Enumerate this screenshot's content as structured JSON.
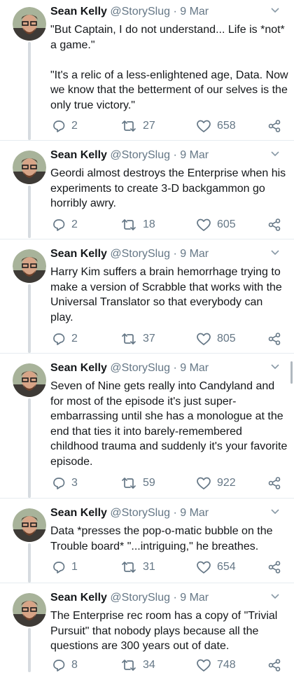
{
  "tweets": [
    {
      "name": "Sean Kelly",
      "handle": "@StorySlug",
      "sep": "·",
      "date": "9 Mar",
      "paragraphs": [
        "\"But Captain, I do not understand... Life is *not* a game.\"",
        "\"It's a relic of a less-enlightened age, Data. Now we know that the betterment of our selves is the only true victory.\""
      ],
      "replies": "2",
      "retweets": "27",
      "likes": "658"
    },
    {
      "name": "Sean Kelly",
      "handle": "@StorySlug",
      "sep": "·",
      "date": "9 Mar",
      "paragraphs": [
        "Geordi almost destroys the Enterprise when his experiments to create 3-D backgammon go horribly awry."
      ],
      "replies": "2",
      "retweets": "18",
      "likes": "605"
    },
    {
      "name": "Sean Kelly",
      "handle": "@StorySlug",
      "sep": "·",
      "date": "9 Mar",
      "paragraphs": [
        "Harry Kim suffers a brain hemorrhage trying to make a version of Scrabble that works with the Universal Translator so that everybody can play."
      ],
      "replies": "2",
      "retweets": "37",
      "likes": "805"
    },
    {
      "name": "Sean Kelly",
      "handle": "@StorySlug",
      "sep": "·",
      "date": "9 Mar",
      "paragraphs": [
        "Seven of Nine gets really into Candyland and for most of the episode it's just super-embarrassing until she has a monologue at the end that ties it into barely-remembered childhood trauma and suddenly it's your favorite episode."
      ],
      "replies": "3",
      "retweets": "59",
      "likes": "922"
    },
    {
      "name": "Sean Kelly",
      "handle": "@StorySlug",
      "sep": "·",
      "date": "9 Mar",
      "paragraphs": [
        "Data *presses the pop-o-matic bubble on the Trouble board* \"...intriguing,\" he breathes."
      ],
      "replies": "1",
      "retweets": "31",
      "likes": "654"
    },
    {
      "name": "Sean Kelly",
      "handle": "@StorySlug",
      "sep": "·",
      "date": "9 Mar",
      "paragraphs": [
        "The Enterprise rec room has a copy of \"Trivial Pursuit\" that nobody plays because all the questions are 300 years out of date."
      ],
      "replies": "8",
      "retweets": "34",
      "likes": "748"
    }
  ],
  "colors": {
    "text": "#14171a",
    "secondary": "#657786",
    "thread": "#d6dbe0",
    "divider": "#e6ecf0"
  }
}
